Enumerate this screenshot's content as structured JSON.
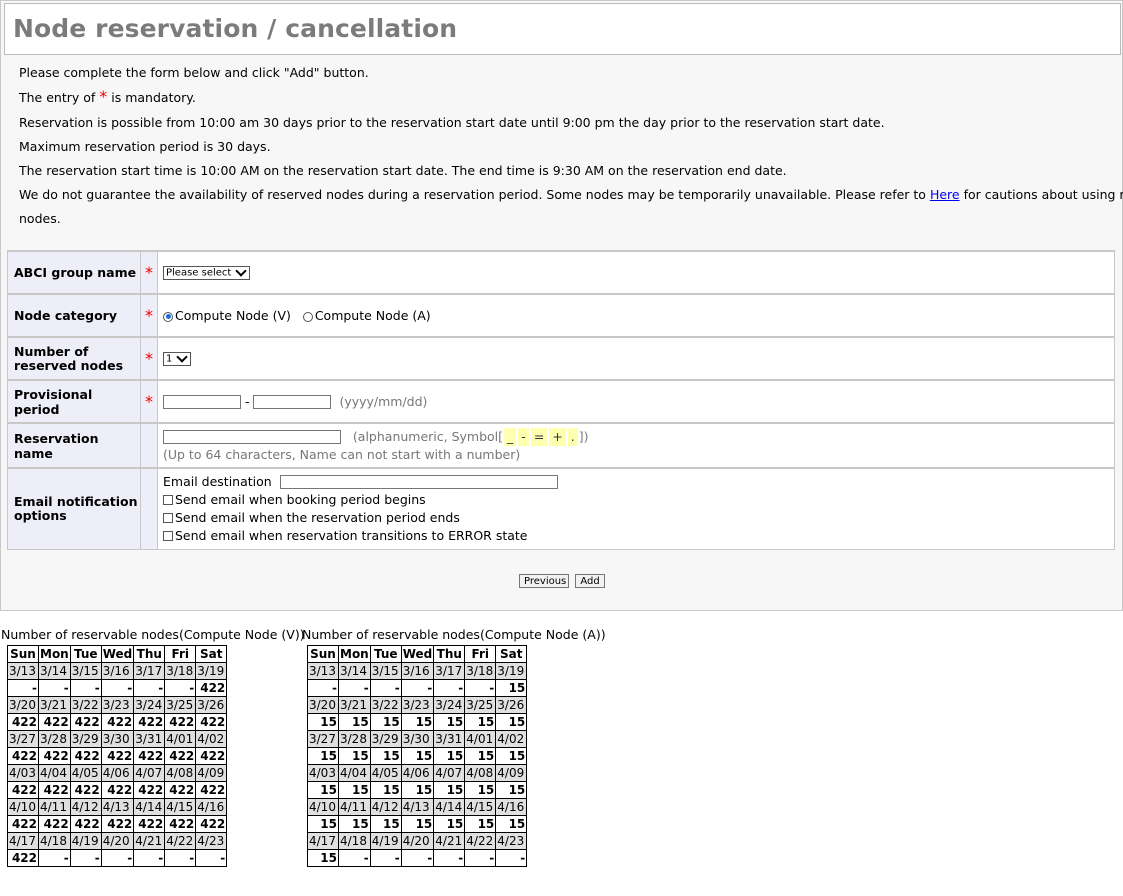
{
  "title": "Node reservation / cancellation",
  "intro": {
    "line1": "Please complete the form below and click \"Add\" button.",
    "line2_pre": "The entry of",
    "line2_star": "*",
    "line2_post": "is mandatory.",
    "line3": "Reservation is possible from 10:00 am 30 days prior to the reservation start date until 9:00 pm the day prior to the reservation start date.",
    "line4": "Maximum reservation period is 30 days.",
    "line5": "The reservation start time is 10:00 AM on the reservation start date. The end time is 9:30 AM on the reservation end date.",
    "line6_pre": "We do not guarantee the availability of reserved nodes during a reservation period. Some nodes may be temporarily unavailable. Please refer to",
    "line6_link": "Here",
    "line6_post": "for cautions about using reserved",
    "line7": "nodes."
  },
  "form": {
    "group": {
      "label": "ABCI group name",
      "star": "*",
      "select": "Please select"
    },
    "category": {
      "label": "Node category",
      "star": "*",
      "opt1": "Compute Node (V)",
      "opt2": "Compute Node (A)"
    },
    "nodes": {
      "label_l1": "Number of",
      "label_l2": "reserved nodes",
      "star": "*",
      "select": "1"
    },
    "period": {
      "label": "Provisional period",
      "star": "*",
      "sep": "-",
      "hint": "(yyyy/mm/dd)"
    },
    "resname": {
      "label": "Reservation name",
      "hint_pre": "(alphanumeric, Symbol[",
      "sym1": "_",
      "sym2": "-",
      "sym3": "=",
      "sym4": "+",
      "sym5": ".",
      "hint_post": "])",
      "hint2": "(Up to 64 characters, Name can not start with a number)"
    },
    "email": {
      "label_l1": "Email notification",
      "label_l2": "options",
      "dest": "Email destination",
      "c1": "Send email when booking period begins",
      "c2": "Send email when the reservation period ends",
      "c3": "Send email when reservation transitions to ERROR state"
    }
  },
  "buttons": {
    "previous": "Previous",
    "add": "Add"
  },
  "calendars": [
    {
      "title": "Number of reservable nodes(Compute Node (V))",
      "headers": [
        "Sun",
        "Mon",
        "Tue",
        "Wed",
        "Thu",
        "Fri",
        "Sat"
      ],
      "weeks": [
        {
          "dates": [
            "3/13",
            "3/14",
            "3/15",
            "3/16",
            "3/17",
            "3/18",
            "3/19"
          ],
          "values": [
            "-",
            "-",
            "-",
            "-",
            "-",
            "-",
            "422"
          ]
        },
        {
          "dates": [
            "3/20",
            "3/21",
            "3/22",
            "3/23",
            "3/24",
            "3/25",
            "3/26"
          ],
          "values": [
            "422",
            "422",
            "422",
            "422",
            "422",
            "422",
            "422"
          ]
        },
        {
          "dates": [
            "3/27",
            "3/28",
            "3/29",
            "3/30",
            "3/31",
            "4/01",
            "4/02"
          ],
          "values": [
            "422",
            "422",
            "422",
            "422",
            "422",
            "422",
            "422"
          ]
        },
        {
          "dates": [
            "4/03",
            "4/04",
            "4/05",
            "4/06",
            "4/07",
            "4/08",
            "4/09"
          ],
          "values": [
            "422",
            "422",
            "422",
            "422",
            "422",
            "422",
            "422"
          ]
        },
        {
          "dates": [
            "4/10",
            "4/11",
            "4/12",
            "4/13",
            "4/14",
            "4/15",
            "4/16"
          ],
          "values": [
            "422",
            "422",
            "422",
            "422",
            "422",
            "422",
            "422"
          ]
        },
        {
          "dates": [
            "4/17",
            "4/18",
            "4/19",
            "4/20",
            "4/21",
            "4/22",
            "4/23"
          ],
          "values": [
            "422",
            "-",
            "-",
            "-",
            "-",
            "-",
            "-"
          ]
        }
      ]
    },
    {
      "title": "Number of reservable nodes(Compute Node (A))",
      "headers": [
        "Sun",
        "Mon",
        "Tue",
        "Wed",
        "Thu",
        "Fri",
        "Sat"
      ],
      "weeks": [
        {
          "dates": [
            "3/13",
            "3/14",
            "3/15",
            "3/16",
            "3/17",
            "3/18",
            "3/19"
          ],
          "values": [
            "-",
            "-",
            "-",
            "-",
            "-",
            "-",
            "15"
          ]
        },
        {
          "dates": [
            "3/20",
            "3/21",
            "3/22",
            "3/23",
            "3/24",
            "3/25",
            "3/26"
          ],
          "values": [
            "15",
            "15",
            "15",
            "15",
            "15",
            "15",
            "15"
          ]
        },
        {
          "dates": [
            "3/27",
            "3/28",
            "3/29",
            "3/30",
            "3/31",
            "4/01",
            "4/02"
          ],
          "values": [
            "15",
            "15",
            "15",
            "15",
            "15",
            "15",
            "15"
          ]
        },
        {
          "dates": [
            "4/03",
            "4/04",
            "4/05",
            "4/06",
            "4/07",
            "4/08",
            "4/09"
          ],
          "values": [
            "15",
            "15",
            "15",
            "15",
            "15",
            "15",
            "15"
          ]
        },
        {
          "dates": [
            "4/10",
            "4/11",
            "4/12",
            "4/13",
            "4/14",
            "4/15",
            "4/16"
          ],
          "values": [
            "15",
            "15",
            "15",
            "15",
            "15",
            "15",
            "15"
          ]
        },
        {
          "dates": [
            "4/17",
            "4/18",
            "4/19",
            "4/20",
            "4/21",
            "4/22",
            "4/23"
          ],
          "values": [
            "15",
            "-",
            "-",
            "-",
            "-",
            "-",
            "-"
          ]
        }
      ]
    }
  ]
}
